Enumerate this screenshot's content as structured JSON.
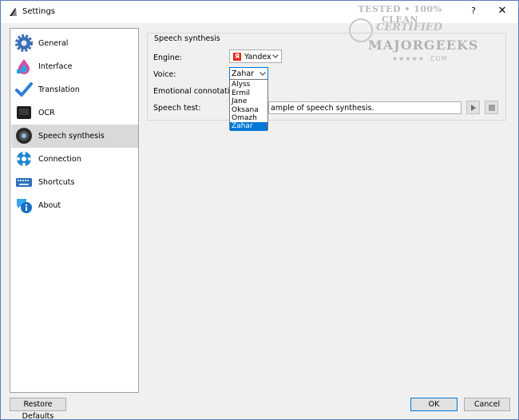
{
  "window": {
    "title": "Settings",
    "help_glyph": "?",
    "close_glyph": "✕"
  },
  "watermark": {
    "line1": "TESTED • 100% CLEAN",
    "line2": "CERTIFIED",
    "line3": "MAJORGEEKS",
    "line4": "★★★★★ .COM"
  },
  "sidebar": {
    "items": [
      {
        "label": "General",
        "icon": "gear-icon"
      },
      {
        "label": "Interface",
        "icon": "paint-icon"
      },
      {
        "label": "Translation",
        "icon": "checkmark-icon"
      },
      {
        "label": "OCR",
        "icon": "ocr-icon"
      },
      {
        "label": "Speech synthesis",
        "icon": "speaker-icon"
      },
      {
        "label": "Connection",
        "icon": "network-icon"
      },
      {
        "label": "Shortcuts",
        "icon": "keyboard-icon"
      },
      {
        "label": "About",
        "icon": "info-icon"
      }
    ],
    "selected_index": 4
  },
  "speech": {
    "group_title": "Speech synthesis",
    "engine_label": "Engine:",
    "engine_logo": "Я",
    "engine_value": "Yandex",
    "voice_label": "Voice:",
    "voice_value": "Zahar",
    "voice_options": [
      "Alyss",
      "Ermil",
      "Jane",
      "Oksana",
      "Omazh",
      "Zahar"
    ],
    "voice_selected_index": 5,
    "emotion_label": "Emotional connotation:",
    "test_label": "Speech test:",
    "test_text": "ample of speech synthesis."
  },
  "footer": {
    "restore_label": "Restore Defaults",
    "ok_label": "OK",
    "cancel_label": "Cancel"
  },
  "colors": {
    "accent": "#0078d7",
    "selected_nav": "#d9d9d9",
    "yandex_red": "#e0281c"
  }
}
